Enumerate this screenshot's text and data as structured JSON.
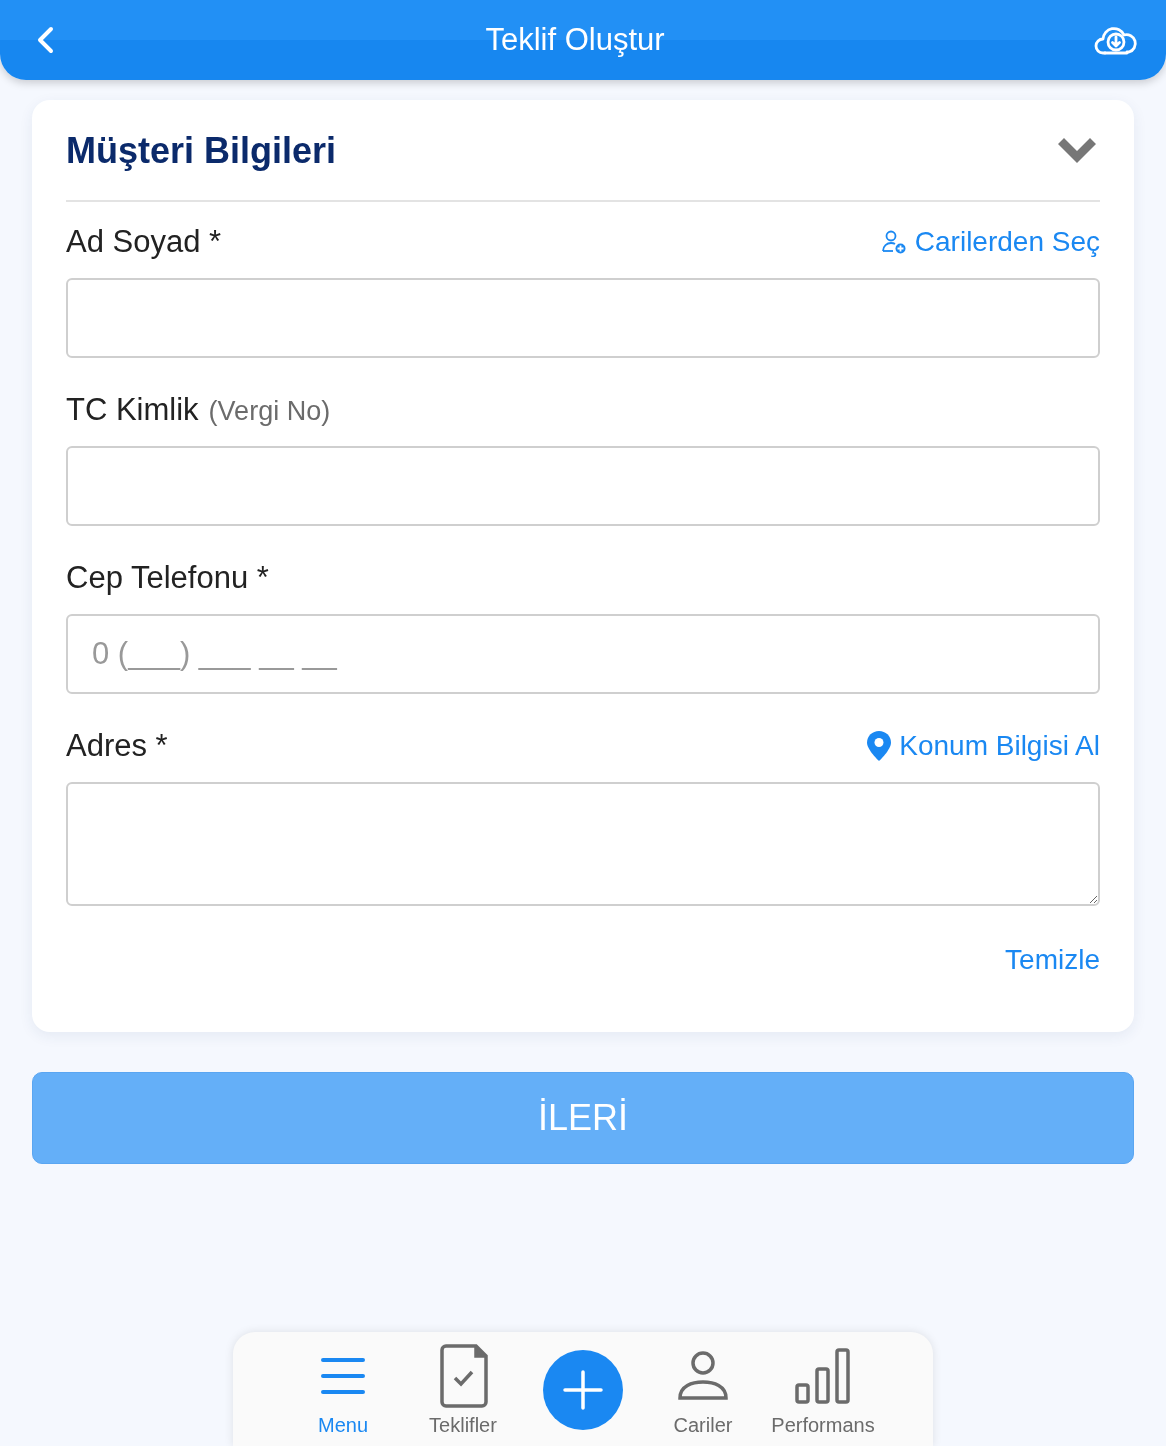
{
  "header": {
    "title": "Teklif Oluştur"
  },
  "section": {
    "title": "Müşteri Bilgileri",
    "expanded": true
  },
  "fields": [
    {
      "label": "Ad Soyad *",
      "kind": "text",
      "action": {
        "kind": "pick-customer",
        "label": "Carilerden Seç"
      }
    },
    {
      "label": "TC Kimlik",
      "hint": "(Vergi No)",
      "kind": "text"
    },
    {
      "label": "Cep Telefonu *",
      "kind": "text",
      "placeholder": "0 (___) ___ __ __"
    },
    {
      "label": "Adres *",
      "kind": "textarea",
      "action": {
        "kind": "location",
        "label": "Konum Bilgisi Al"
      }
    }
  ],
  "clear_link": "Temizle",
  "next_button": {
    "label": "İLERİ",
    "disabled": true
  },
  "nav": [
    {
      "kind": "menu",
      "label": "Menu",
      "selected": true
    },
    {
      "kind": "offers",
      "label": "Teklifler",
      "selected": false
    },
    {
      "kind": "add",
      "selected": false
    },
    {
      "kind": "customers",
      "label": "Cariler",
      "selected": false
    },
    {
      "kind": "performance",
      "label": "Performans",
      "selected": false
    }
  ]
}
